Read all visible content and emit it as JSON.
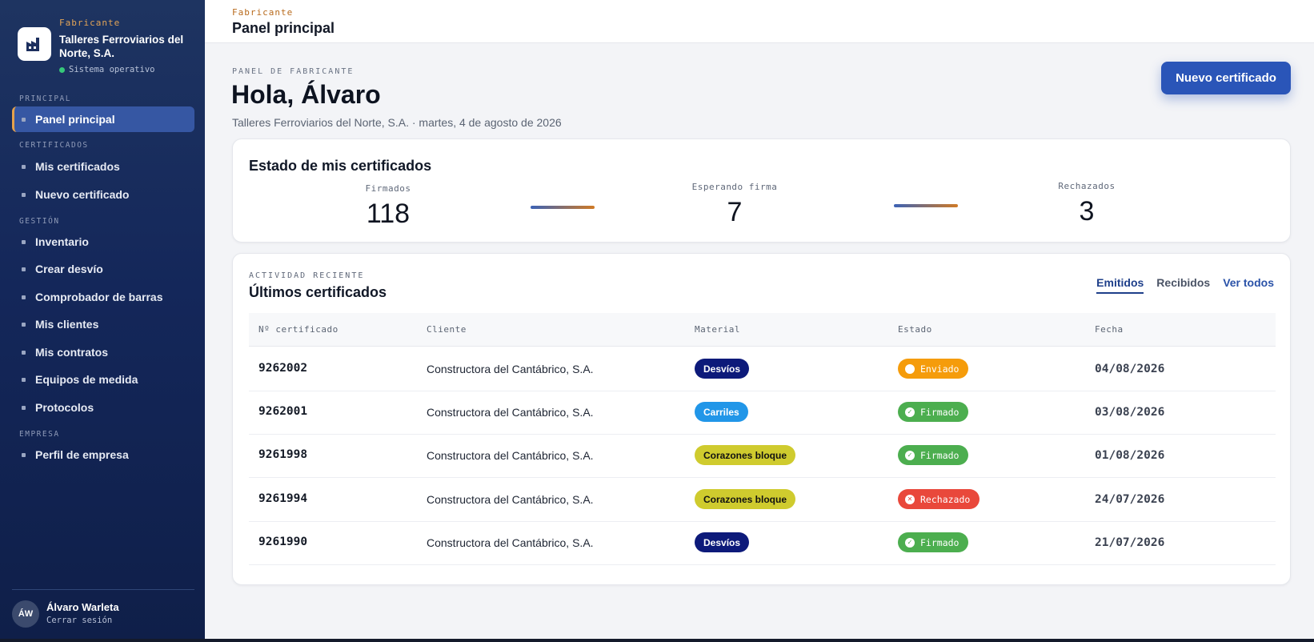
{
  "brand": {
    "role": "Fabricante",
    "name": "Talleres Ferroviarios del Norte, S.A.",
    "status": "Sistema operativo"
  },
  "nav": {
    "sections": {
      "principal": "PRINCIPAL",
      "certificados": "CERTIFICADOS",
      "gestion": "GESTIÓN",
      "empresa": "EMPRESA"
    },
    "items": {
      "panel": "Panel principal",
      "mis_certificados": "Mis certificados",
      "nuevo_certificado": "Nuevo certificado",
      "inventario": "Inventario",
      "crear_desvio": "Crear desvío",
      "comprobador": "Comprobador de barras",
      "clientes": "Mis clientes",
      "contratos": "Mis contratos",
      "equipos": "Equipos de medida",
      "protocolos": "Protocolos",
      "perfil": "Perfil de empresa"
    }
  },
  "user": {
    "initials": "ÁW",
    "name": "Álvaro Warleta",
    "logout": "Cerrar sesión"
  },
  "topbar": {
    "role": "Fabricante",
    "title": "Panel principal"
  },
  "header": {
    "kicker": "PANEL DE FABRICANTE",
    "greeting": "Hola, Álvaro",
    "subline": "Talleres Ferroviarios del Norte, S.A. · martes, 4 de agosto de 2026",
    "new_button": "Nuevo certificado"
  },
  "status_card": {
    "title": "Estado de mis certificados",
    "stats": [
      {
        "label": "Firmados",
        "value": "118"
      },
      {
        "label": "Esperando firma",
        "value": "7"
      },
      {
        "label": "Rechazados",
        "value": "3"
      }
    ]
  },
  "recent": {
    "kicker": "ACTIVIDAD RECIENTE",
    "title": "Últimos certificados",
    "tabs": {
      "emitidos": "Emitidos",
      "recibidos": "Recibidos",
      "ver_todos": "Ver todos"
    },
    "columns": [
      "Nº certificado",
      "Cliente",
      "Material",
      "Estado",
      "Fecha"
    ],
    "rows": [
      {
        "num": "9262002",
        "client": "Constructora del Cantábrico, S.A.",
        "material": "Desvíos",
        "status": "Enviado",
        "date": "04/08/2026"
      },
      {
        "num": "9262001",
        "client": "Constructora del Cantábrico, S.A.",
        "material": "Carriles",
        "status": "Firmado",
        "date": "03/08/2026"
      },
      {
        "num": "9261998",
        "client": "Constructora del Cantábrico, S.A.",
        "material": "Corazones bloque",
        "status": "Firmado",
        "date": "01/08/2026"
      },
      {
        "num": "9261994",
        "client": "Constructora del Cantábrico, S.A.",
        "material": "Corazones bloque",
        "status": "Rechazado",
        "date": "24/07/2026"
      },
      {
        "num": "9261990",
        "client": "Constructora del Cantábrico, S.A.",
        "material": "Desvíos",
        "status": "Firmado",
        "date": "21/07/2026"
      }
    ]
  },
  "colors": {
    "accent": "#2a55b8",
    "desvios": "#0d1a7a",
    "carriles": "#2196e8",
    "corazones": "#cfcb2e",
    "enviado": "#f59c0b",
    "firmado": "#4cae4f",
    "rechazado": "#e9483b"
  }
}
